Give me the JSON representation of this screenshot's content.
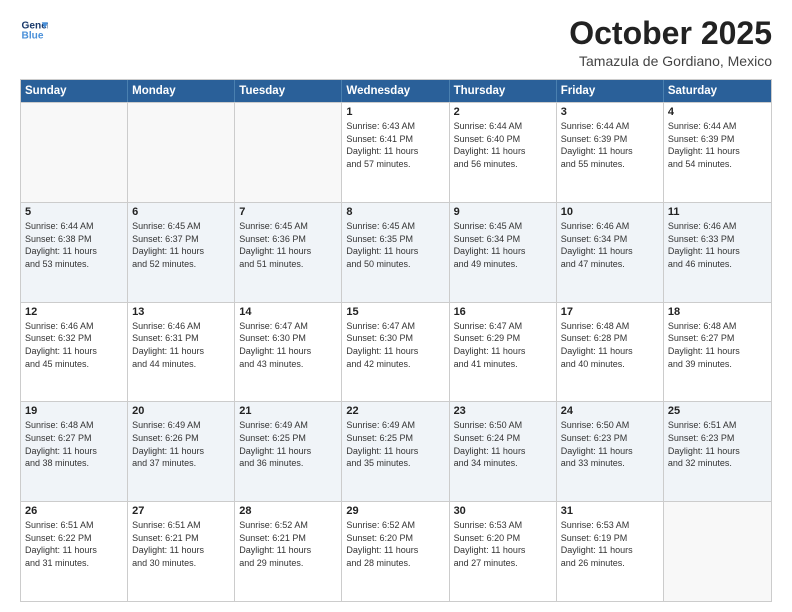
{
  "header": {
    "logo": {
      "line1": "General",
      "line2": "Blue"
    },
    "title": "October 2025",
    "subtitle": "Tamazula de Gordiano, Mexico"
  },
  "weekdays": [
    "Sunday",
    "Monday",
    "Tuesday",
    "Wednesday",
    "Thursday",
    "Friday",
    "Saturday"
  ],
  "weeks": [
    [
      {
        "day": "",
        "info": ""
      },
      {
        "day": "",
        "info": ""
      },
      {
        "day": "",
        "info": ""
      },
      {
        "day": "1",
        "info": "Sunrise: 6:43 AM\nSunset: 6:41 PM\nDaylight: 11 hours\nand 57 minutes."
      },
      {
        "day": "2",
        "info": "Sunrise: 6:44 AM\nSunset: 6:40 PM\nDaylight: 11 hours\nand 56 minutes."
      },
      {
        "day": "3",
        "info": "Sunrise: 6:44 AM\nSunset: 6:39 PM\nDaylight: 11 hours\nand 55 minutes."
      },
      {
        "day": "4",
        "info": "Sunrise: 6:44 AM\nSunset: 6:39 PM\nDaylight: 11 hours\nand 54 minutes."
      }
    ],
    [
      {
        "day": "5",
        "info": "Sunrise: 6:44 AM\nSunset: 6:38 PM\nDaylight: 11 hours\nand 53 minutes."
      },
      {
        "day": "6",
        "info": "Sunrise: 6:45 AM\nSunset: 6:37 PM\nDaylight: 11 hours\nand 52 minutes."
      },
      {
        "day": "7",
        "info": "Sunrise: 6:45 AM\nSunset: 6:36 PM\nDaylight: 11 hours\nand 51 minutes."
      },
      {
        "day": "8",
        "info": "Sunrise: 6:45 AM\nSunset: 6:35 PM\nDaylight: 11 hours\nand 50 minutes."
      },
      {
        "day": "9",
        "info": "Sunrise: 6:45 AM\nSunset: 6:34 PM\nDaylight: 11 hours\nand 49 minutes."
      },
      {
        "day": "10",
        "info": "Sunrise: 6:46 AM\nSunset: 6:34 PM\nDaylight: 11 hours\nand 47 minutes."
      },
      {
        "day": "11",
        "info": "Sunrise: 6:46 AM\nSunset: 6:33 PM\nDaylight: 11 hours\nand 46 minutes."
      }
    ],
    [
      {
        "day": "12",
        "info": "Sunrise: 6:46 AM\nSunset: 6:32 PM\nDaylight: 11 hours\nand 45 minutes."
      },
      {
        "day": "13",
        "info": "Sunrise: 6:46 AM\nSunset: 6:31 PM\nDaylight: 11 hours\nand 44 minutes."
      },
      {
        "day": "14",
        "info": "Sunrise: 6:47 AM\nSunset: 6:30 PM\nDaylight: 11 hours\nand 43 minutes."
      },
      {
        "day": "15",
        "info": "Sunrise: 6:47 AM\nSunset: 6:30 PM\nDaylight: 11 hours\nand 42 minutes."
      },
      {
        "day": "16",
        "info": "Sunrise: 6:47 AM\nSunset: 6:29 PM\nDaylight: 11 hours\nand 41 minutes."
      },
      {
        "day": "17",
        "info": "Sunrise: 6:48 AM\nSunset: 6:28 PM\nDaylight: 11 hours\nand 40 minutes."
      },
      {
        "day": "18",
        "info": "Sunrise: 6:48 AM\nSunset: 6:27 PM\nDaylight: 11 hours\nand 39 minutes."
      }
    ],
    [
      {
        "day": "19",
        "info": "Sunrise: 6:48 AM\nSunset: 6:27 PM\nDaylight: 11 hours\nand 38 minutes."
      },
      {
        "day": "20",
        "info": "Sunrise: 6:49 AM\nSunset: 6:26 PM\nDaylight: 11 hours\nand 37 minutes."
      },
      {
        "day": "21",
        "info": "Sunrise: 6:49 AM\nSunset: 6:25 PM\nDaylight: 11 hours\nand 36 minutes."
      },
      {
        "day": "22",
        "info": "Sunrise: 6:49 AM\nSunset: 6:25 PM\nDaylight: 11 hours\nand 35 minutes."
      },
      {
        "day": "23",
        "info": "Sunrise: 6:50 AM\nSunset: 6:24 PM\nDaylight: 11 hours\nand 34 minutes."
      },
      {
        "day": "24",
        "info": "Sunrise: 6:50 AM\nSunset: 6:23 PM\nDaylight: 11 hours\nand 33 minutes."
      },
      {
        "day": "25",
        "info": "Sunrise: 6:51 AM\nSunset: 6:23 PM\nDaylight: 11 hours\nand 32 minutes."
      }
    ],
    [
      {
        "day": "26",
        "info": "Sunrise: 6:51 AM\nSunset: 6:22 PM\nDaylight: 11 hours\nand 31 minutes."
      },
      {
        "day": "27",
        "info": "Sunrise: 6:51 AM\nSunset: 6:21 PM\nDaylight: 11 hours\nand 30 minutes."
      },
      {
        "day": "28",
        "info": "Sunrise: 6:52 AM\nSunset: 6:21 PM\nDaylight: 11 hours\nand 29 minutes."
      },
      {
        "day": "29",
        "info": "Sunrise: 6:52 AM\nSunset: 6:20 PM\nDaylight: 11 hours\nand 28 minutes."
      },
      {
        "day": "30",
        "info": "Sunrise: 6:53 AM\nSunset: 6:20 PM\nDaylight: 11 hours\nand 27 minutes."
      },
      {
        "day": "31",
        "info": "Sunrise: 6:53 AM\nSunset: 6:19 PM\nDaylight: 11 hours\nand 26 minutes."
      },
      {
        "day": "",
        "info": ""
      }
    ]
  ],
  "alt_rows": [
    1,
    3
  ],
  "colors": {
    "header_bg": "#2a6099",
    "header_text": "#ffffff",
    "alt_bg": "#f0f4f8",
    "border": "#cccccc"
  }
}
